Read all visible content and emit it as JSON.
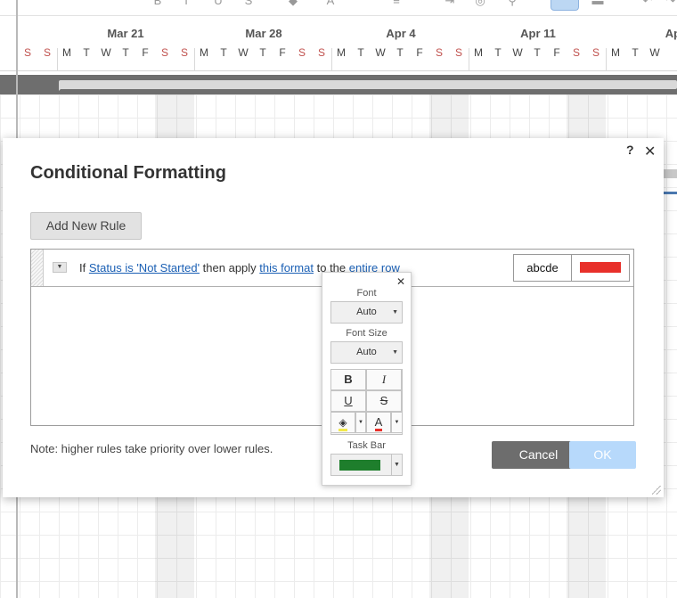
{
  "gantt": {
    "weeks": [
      "Mar 21",
      "Mar 28",
      "Apr 4",
      "Apr 11",
      "Apr"
    ],
    "days": [
      "S",
      "S",
      "M",
      "T",
      "W",
      "T",
      "F",
      "S",
      "S",
      "M",
      "T",
      "W",
      "T",
      "F",
      "S",
      "S",
      "M",
      "T",
      "W",
      "T",
      "F",
      "S",
      "S",
      "M",
      "T",
      "W",
      "T",
      "F",
      "S",
      "S",
      "M",
      "T",
      "W"
    ]
  },
  "dialog": {
    "title": "Conditional Formatting",
    "help_label": "?",
    "close_label": "✕",
    "add_rule_label": "Add New Rule",
    "rule": {
      "if_text": "If",
      "condition_link": "Status is 'Not Started'",
      "then_text": "then apply",
      "format_link": "this format",
      "to_text": "to the",
      "target_link": "entire row",
      "preview_text": "abcde",
      "preview_bar_color": "#e8302a"
    },
    "note": "Note: higher rules take priority over lower rules.",
    "cancel_label": "Cancel",
    "ok_label": "OK"
  },
  "format_popup": {
    "close_label": "✕",
    "font_label": "Font",
    "font_value": "Auto",
    "font_size_label": "Font Size",
    "font_size_value": "Auto",
    "bold_label": "B",
    "italic_label": "I",
    "underline_label": "U",
    "strike_label": "S",
    "text_color_label": "A",
    "task_bar_label": "Task Bar",
    "task_bar_color": "#1e7e2c"
  }
}
